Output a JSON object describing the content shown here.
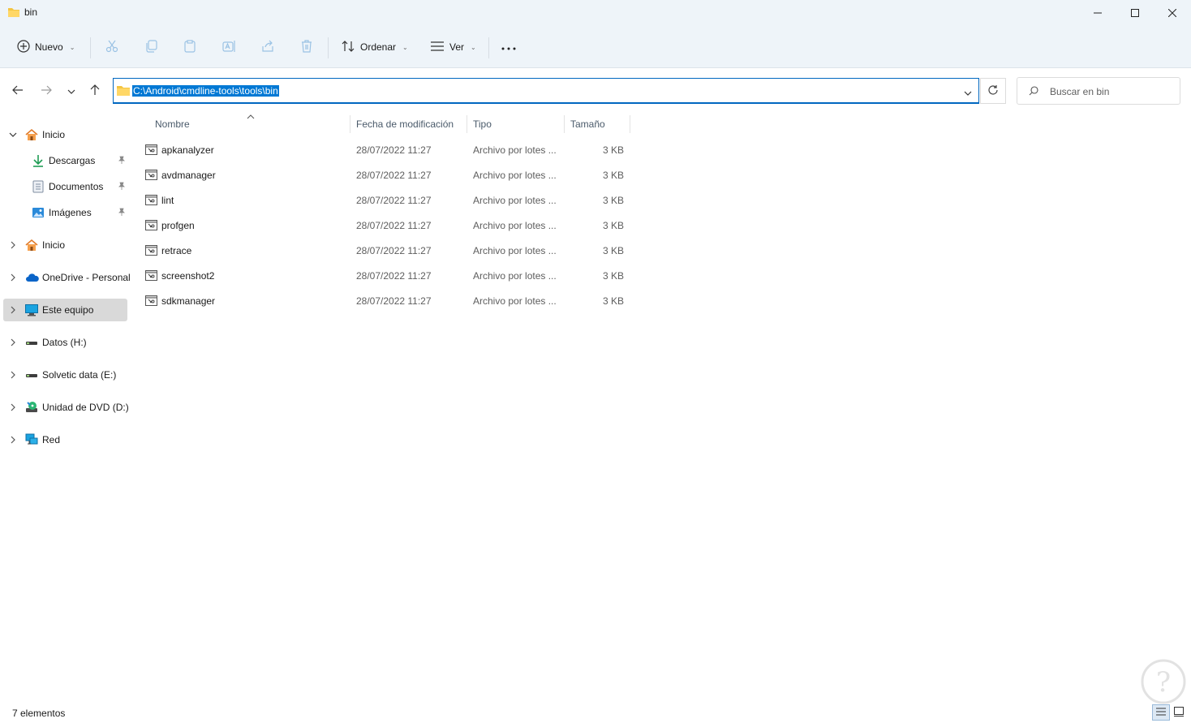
{
  "window": {
    "title": "bin",
    "controls": [
      "minimize",
      "maximize",
      "close"
    ]
  },
  "toolbar": {
    "new_label": "Nuevo",
    "sort_label": "Ordenar",
    "view_label": "Ver",
    "more_label": "···",
    "icons": [
      "cut-icon",
      "copy-icon",
      "paste-icon",
      "rename-icon",
      "share-icon",
      "delete-icon"
    ]
  },
  "address": {
    "path": "C:\\Android\\cmdline-tools\\tools\\bin"
  },
  "search": {
    "placeholder": "Buscar en bin"
  },
  "sidebar": {
    "items": [
      {
        "label": "Inicio",
        "icon": "home-icon",
        "expanded": true
      },
      {
        "label": "Descargas",
        "icon": "download-icon",
        "pinned": true
      },
      {
        "label": "Documentos",
        "icon": "documents-icon",
        "pinned": true
      },
      {
        "label": "Imágenes",
        "icon": "pictures-icon",
        "pinned": true
      },
      {
        "label": "Inicio",
        "icon": "home-icon",
        "expanded": false
      },
      {
        "label": "OneDrive - Personal",
        "icon": "cloud-icon",
        "expanded": false
      },
      {
        "label": "Este equipo",
        "icon": "computer-icon",
        "selected": true
      },
      {
        "label": "Datos (H:)",
        "icon": "drive-icon"
      },
      {
        "label": "Solvetic data (E:)",
        "icon": "drive-icon"
      },
      {
        "label": "Unidad de DVD (D:)",
        "icon": "dvd-icon"
      },
      {
        "label": "Red",
        "icon": "network-icon"
      }
    ]
  },
  "columns": {
    "name": "Nombre",
    "date": "Fecha de modificación",
    "type": "Tipo",
    "size": "Tamaño"
  },
  "files": [
    {
      "name": "apkanalyzer",
      "date": "28/07/2022 11:27",
      "type": "Archivo por lotes ...",
      "size": "3 KB"
    },
    {
      "name": "avdmanager",
      "date": "28/07/2022 11:27",
      "type": "Archivo por lotes ...",
      "size": "3 KB"
    },
    {
      "name": "lint",
      "date": "28/07/2022 11:27",
      "type": "Archivo por lotes ...",
      "size": "3 KB"
    },
    {
      "name": "profgen",
      "date": "28/07/2022 11:27",
      "type": "Archivo por lotes ...",
      "size": "3 KB"
    },
    {
      "name": "retrace",
      "date": "28/07/2022 11:27",
      "type": "Archivo por lotes ...",
      "size": "3 KB"
    },
    {
      "name": "screenshot2",
      "date": "28/07/2022 11:27",
      "type": "Archivo por lotes ...",
      "size": "3 KB"
    },
    {
      "name": "sdkmanager",
      "date": "28/07/2022 11:27",
      "type": "Archivo por lotes ...",
      "size": "3 KB"
    }
  ],
  "status": {
    "count": "7 elementos"
  },
  "colors": {
    "accent": "#0078d4",
    "chrome": "#eef4f9",
    "folder": "#f4c542"
  }
}
